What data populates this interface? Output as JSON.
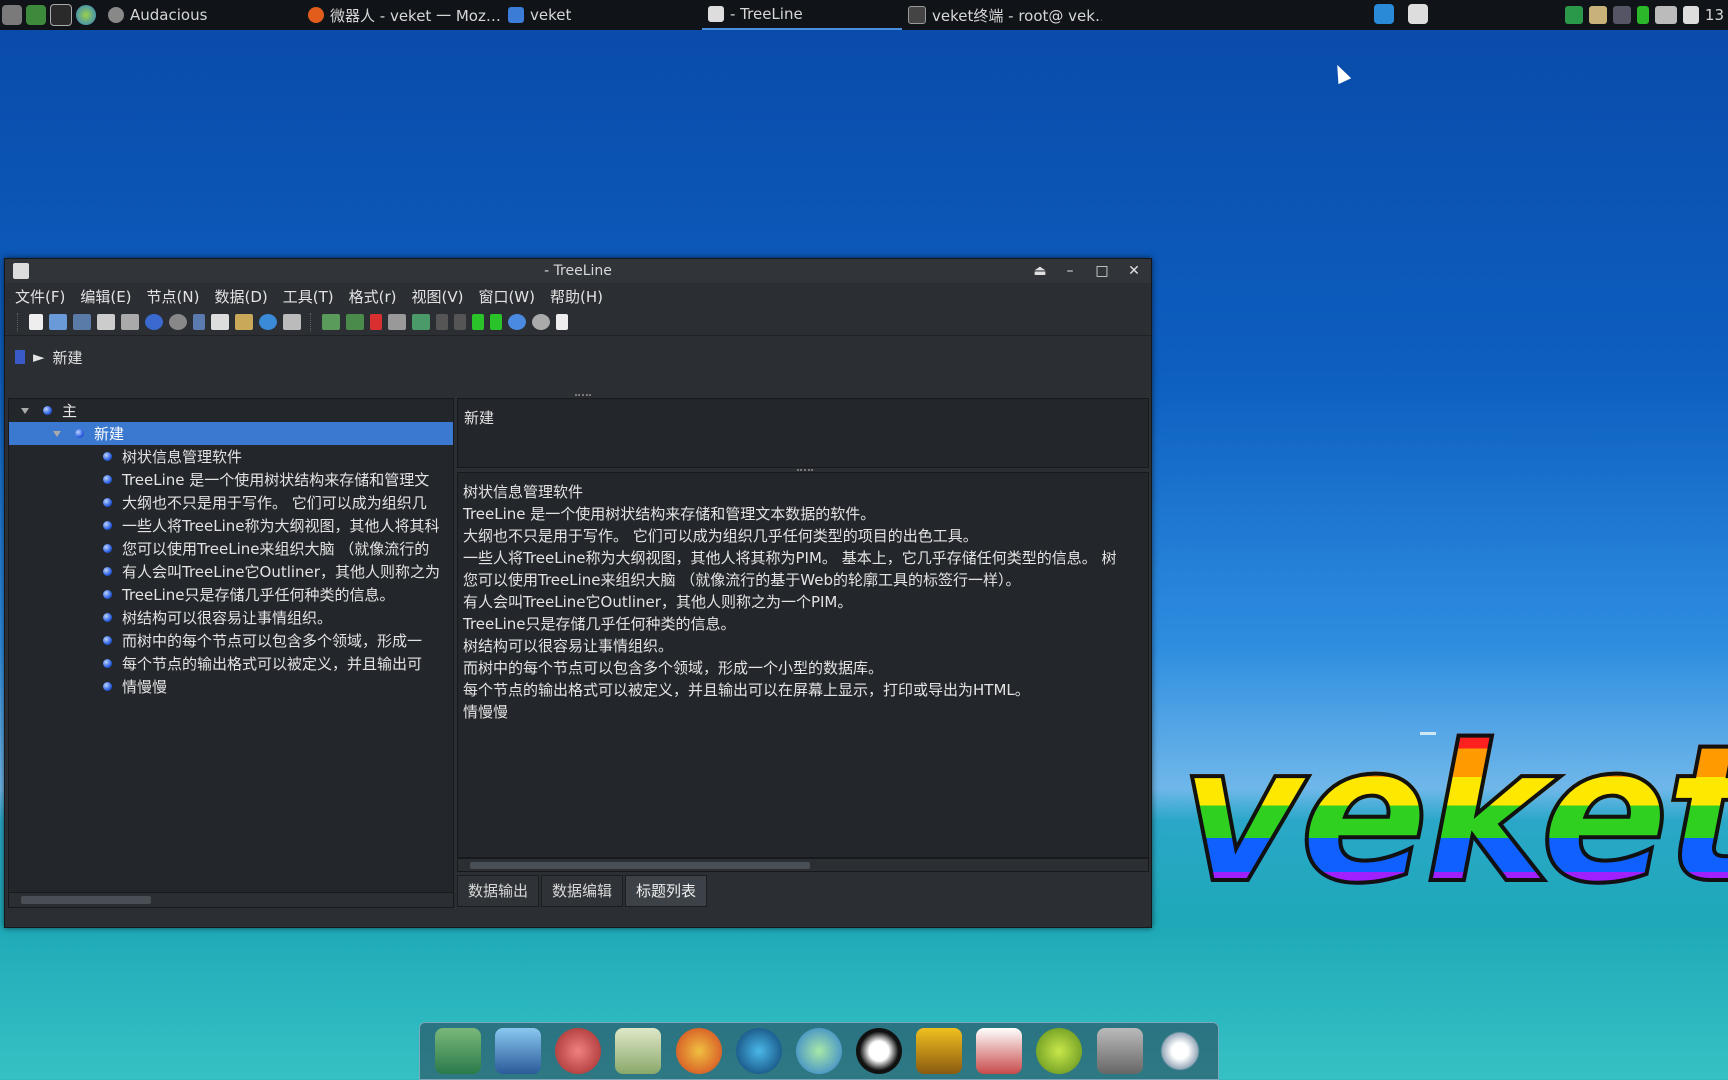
{
  "taskbar": {
    "tasks": [
      {
        "label": "Audacious",
        "color": "#888888",
        "active": false
      },
      {
        "label": "微器人 - veket 一 Moz…",
        "color": "#e25c1c",
        "active": false
      },
      {
        "label": "veket",
        "color": "#3a7cd6",
        "active": false
      },
      {
        "label": "- TreeLine",
        "color": "#dddddd",
        "active": true
      },
      {
        "label": "veket终端 - root@ vek…",
        "color": "#444444",
        "active": false
      }
    ],
    "clock": "13"
  },
  "window": {
    "title": "- TreeLine",
    "menu": [
      "文件(F)",
      "编辑(E)",
      "节点(N)",
      "数据(D)",
      "工具(T)",
      "格式(r)",
      "视图(V)",
      "窗口(W)",
      "帮助(H)"
    ],
    "breadcrumb": {
      "separator": "►",
      "current": "新建"
    },
    "tree": {
      "root": "主",
      "selected": "新建",
      "children": [
        "树状信息管理软件",
        "TreeLine 是一个使用树状结构来存储和管理文",
        "大纲也不只是用于写作。 它们可以成为组织几",
        "一些人将TreeLine称为大纲视图，其他人将其科",
        "您可以使用TreeLine来组织大脑 （就像流行的",
        "有人会叫TreeLine它Outliner，其他人则称之为",
        "TreeLine只是存储几乎任何种类的信息。",
        "树结构可以很容易让事情组织。",
        "而树中的每个节点可以包含多个领域，形成一",
        "每个节点的输出格式可以被定义，并且输出可",
        "情慢慢"
      ]
    },
    "right_title": "新建",
    "output_lines": [
      "树状信息管理软件",
      "TreeLine 是一个使用树状结构来存储和管理文本数据的软件。",
      "大纲也不只是用于写作。 它们可以成为组织几乎任何类型的项目的出色工具。",
      "一些人将TreeLine称为大纲视图，其他人将其称为PIM。 基本上，它几乎存储任何类型的信息。 树",
      "您可以使用TreeLine来组织大脑 （就像流行的基于Web的轮廓工具的标签行一样）。",
      "有人会叫TreeLine它Outliner，其他人则称之为一个PIM。",
      "TreeLine只是存储几乎任何种类的信息。",
      "树结构可以很容易让事情组织。",
      "而树中的每个节点可以包含多个领域，形成一个小型的数据库。",
      "每个节点的输出格式可以被定义，并且输出可以在屏幕上显示，打印或导出为HTML。",
      "情慢慢"
    ],
    "tabs": [
      {
        "label": "数据输出",
        "active": false
      },
      {
        "label": "数据编辑",
        "active": false
      },
      {
        "label": "标题列表",
        "active": true
      }
    ]
  },
  "wallpaper": {
    "logo_text": "veket"
  }
}
